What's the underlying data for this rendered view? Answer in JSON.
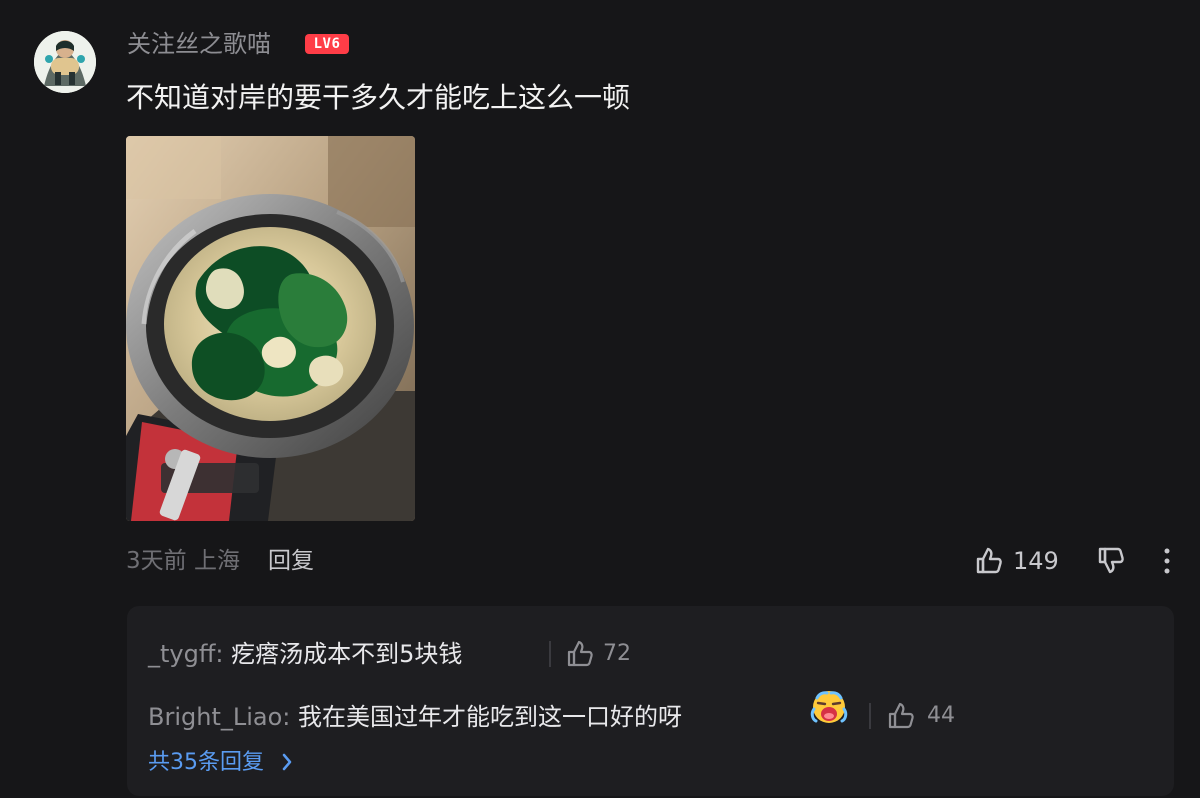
{
  "comment": {
    "username": "关注丝之歌喵",
    "level_badge": "LV6",
    "text": "不知道对岸的要干多久才能吃上这么一顿",
    "time_location": "3天前 上海",
    "reply_label": "回复",
    "like_count": "149"
  },
  "replies": {
    "items": [
      {
        "user": "_tygff:",
        "text": "疙瘩汤成本不到5块钱",
        "like_count": "72"
      },
      {
        "user": "Bright_Liao:",
        "text": "我在美国过年才能吃到这一口好的呀",
        "like_count": "44"
      }
    ],
    "more_label": "共35条回复"
  },
  "theme": {
    "background": "#161618",
    "reply_box": "#1e1e21",
    "accent_blue": "#5a9cf2",
    "badge_red": "#ff3d47"
  },
  "icons": {
    "avatar": "anime-character-avatar",
    "like": "thumbs-up-icon",
    "dislike": "thumbs-down-icon",
    "more": "more-vertical-icon",
    "emoji": "crying-face-emoji",
    "chevron": "chevron-right-icon"
  }
}
